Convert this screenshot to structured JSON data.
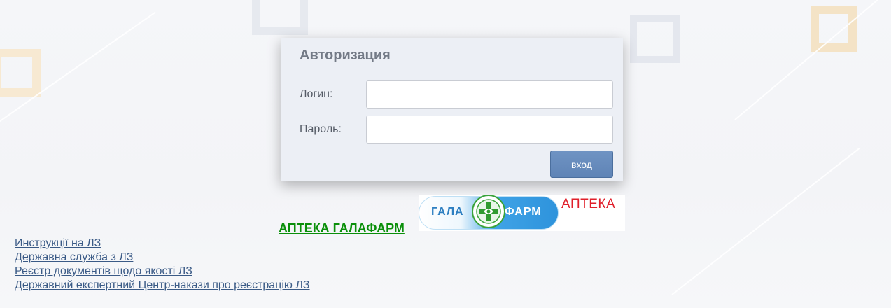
{
  "login": {
    "title": "Авторизация",
    "login_label": "Логин:",
    "password_label": "Пароль:",
    "login_value": "",
    "password_value": "",
    "submit_label": "вход"
  },
  "pharmacy": {
    "link_text": "АПТЕКА ГАЛАФАРМ",
    "logo_left": "ГАЛА",
    "logo_right": "ФАРМ",
    "logo_word": "АПТЕКА"
  },
  "links": [
    "Инструкції на ЛЗ",
    "Державна служба з ЛЗ",
    "Реєстр документів щодо якості ЛЗ",
    "Державний експертний Центр-накази про реєстрацію ЛЗ"
  ],
  "colors": {
    "panel_bg": "#eceff5",
    "button_bg": "#6389bb",
    "pharmacy_link": "#0a8f0a",
    "link": "#3a5a86",
    "logo_red": "#e0202b",
    "logo_blue": "#2e93dc"
  }
}
